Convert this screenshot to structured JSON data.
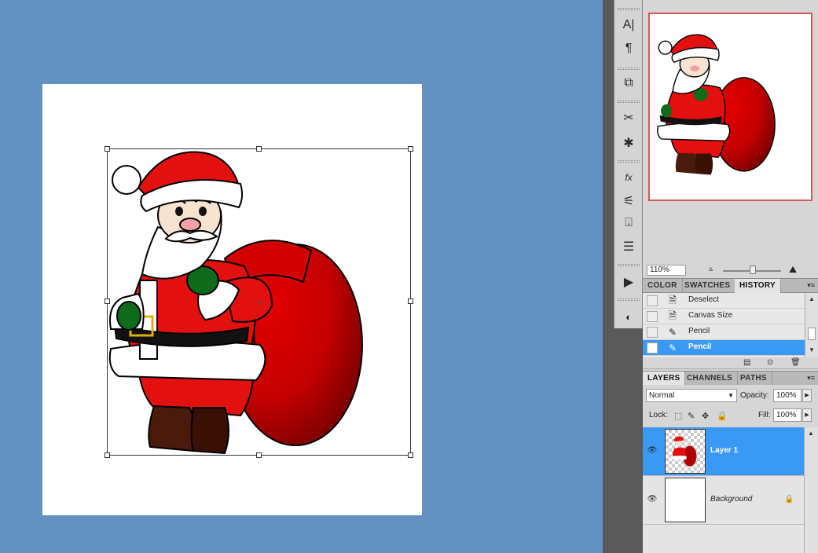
{
  "navigator": {
    "zoom": "110%"
  },
  "history_panel": {
    "tabs": [
      "COLOR",
      "SWATCHES",
      "HISTORY"
    ],
    "active_tab": "HISTORY",
    "items": [
      {
        "label": "Deselect",
        "icon": "document-icon",
        "selected": false
      },
      {
        "label": "Canvas Size",
        "icon": "document-icon",
        "selected": false
      },
      {
        "label": "Pencil",
        "icon": "pencil-icon",
        "selected": false
      },
      {
        "label": "Pencil",
        "icon": "pencil-icon",
        "selected": true
      }
    ]
  },
  "layers_panel": {
    "tabs": [
      "LAYERS",
      "CHANNELS",
      "PATHS"
    ],
    "active_tab": "LAYERS",
    "blend_mode": "Normal",
    "opacity_label": "Opacity:",
    "opacity": "100%",
    "lock_label": "Lock:",
    "fill_label": "Fill:",
    "fill": "100%",
    "layers": [
      {
        "name": "Layer 1",
        "selected": true,
        "visible": true,
        "locked": false
      },
      {
        "name": "Background",
        "selected": false,
        "visible": true,
        "locked": true
      }
    ]
  },
  "colors": {
    "workspace_bg": "#6391c1",
    "selection_blue": "#3a99f5",
    "santa_red": "#e31010"
  }
}
